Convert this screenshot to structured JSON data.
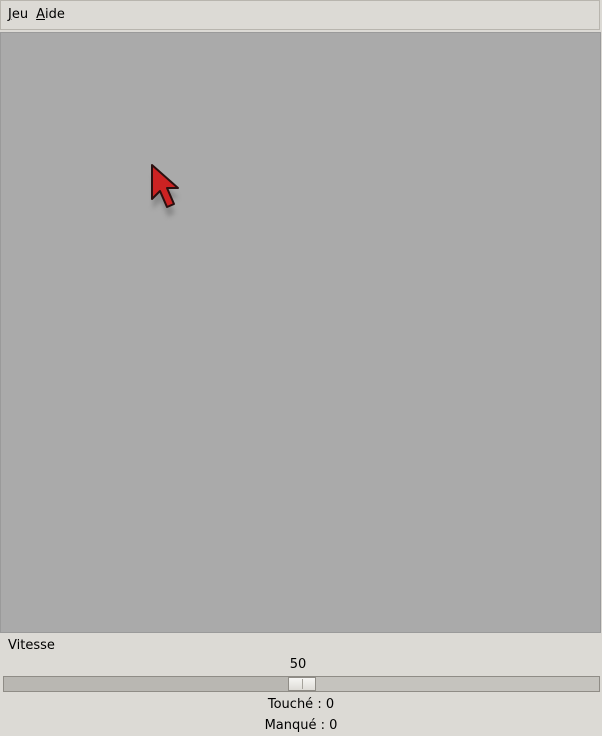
{
  "menubar": {
    "items": [
      {
        "mnemonic": "J",
        "rest": "eu"
      },
      {
        "mnemonic": "A",
        "rest": "ide"
      }
    ]
  },
  "game": {
    "background_color": "#aaaaaa",
    "target_icon": "red-arrow-cursor-icon",
    "target_color": "#cc2222"
  },
  "speed": {
    "label": "Vitesse",
    "value": "50",
    "min": 0,
    "max": 100,
    "value_number": 50
  },
  "stats": {
    "hits": "Touché : 0",
    "misses": "Manqué : 0"
  }
}
